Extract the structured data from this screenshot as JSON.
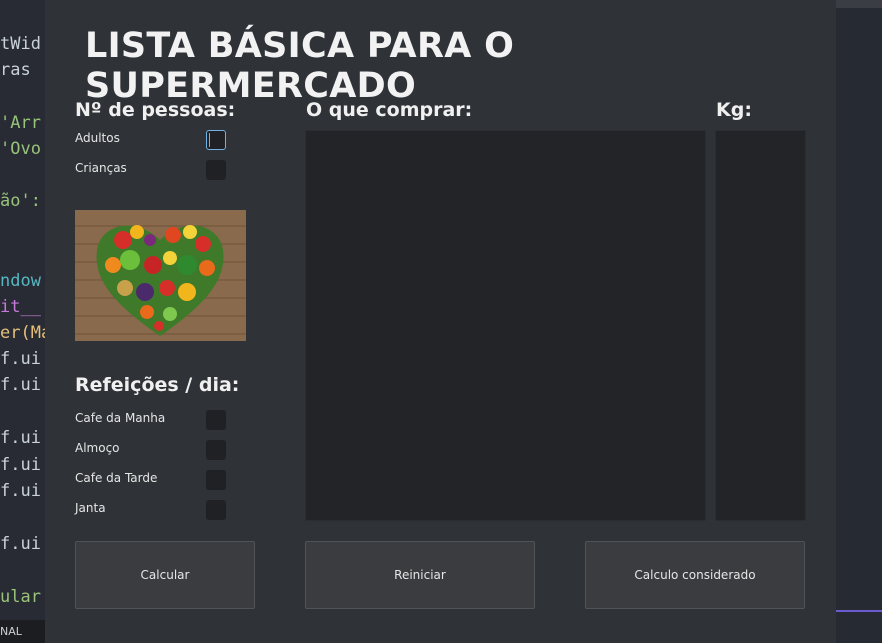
{
  "background_editor": {
    "code_lines": [
      {
        "text": "tWid",
        "color": "#c9d1d9"
      },
      {
        "text": "ras ",
        "color": "#c9d1d9"
      },
      {
        "text": "'Arr",
        "color": "#98c379"
      },
      {
        "text": "'Ovo",
        "color": "#98c379"
      },
      {
        "text": "ão':",
        "color": "#98c379"
      },
      {
        "text": "ndow",
        "color": "#56b6c2"
      },
      {
        "text": "it__",
        "color": "#c678dd"
      },
      {
        "text": "er(Ma",
        "color": "#e5c07b"
      },
      {
        "text": "f.ui",
        "color": "#c9d1d9"
      },
      {
        "text": "f.ui.",
        "color": "#c9d1d9"
      },
      {
        "text": "f.ui.",
        "color": "#c9d1d9"
      },
      {
        "text": "f.ui.",
        "color": "#c9d1d9"
      },
      {
        "text": "f.ui.",
        "color": "#c9d1d9"
      },
      {
        "text": "f.ui.",
        "color": "#c9d1d9"
      },
      {
        "text": "ular",
        "color": "#98c379"
      }
    ],
    "status_text": "NAL"
  },
  "app": {
    "title": "LISTA BÁSICA PARA O SUPERMERCADO",
    "people_section": {
      "heading": "Nº de pessoas:",
      "options": [
        {
          "label": "Adultos",
          "checked": false,
          "focused": true
        },
        {
          "label": "Crianças",
          "checked": false,
          "focused": false
        }
      ]
    },
    "meals_section": {
      "heading": "Refeições / dia:",
      "options": [
        {
          "label": "Cafe da Manha",
          "checked": false
        },
        {
          "label": "Almoço",
          "checked": false
        },
        {
          "label": "Cafe da Tarde",
          "checked": false
        },
        {
          "label": "Janta",
          "checked": false
        }
      ]
    },
    "shopping_list": {
      "heading": "O que comprar:",
      "items": []
    },
    "kg_list": {
      "heading": "Kg:",
      "items": []
    },
    "buttons": {
      "calculate": "Calcular",
      "reset": "Reiniciar",
      "considered": "Calculo considerado"
    },
    "image_icon": "vegetables-heart-image",
    "colors": {
      "window_bg": "#2f3237",
      "focus_accent": "#6fb3e6"
    }
  }
}
